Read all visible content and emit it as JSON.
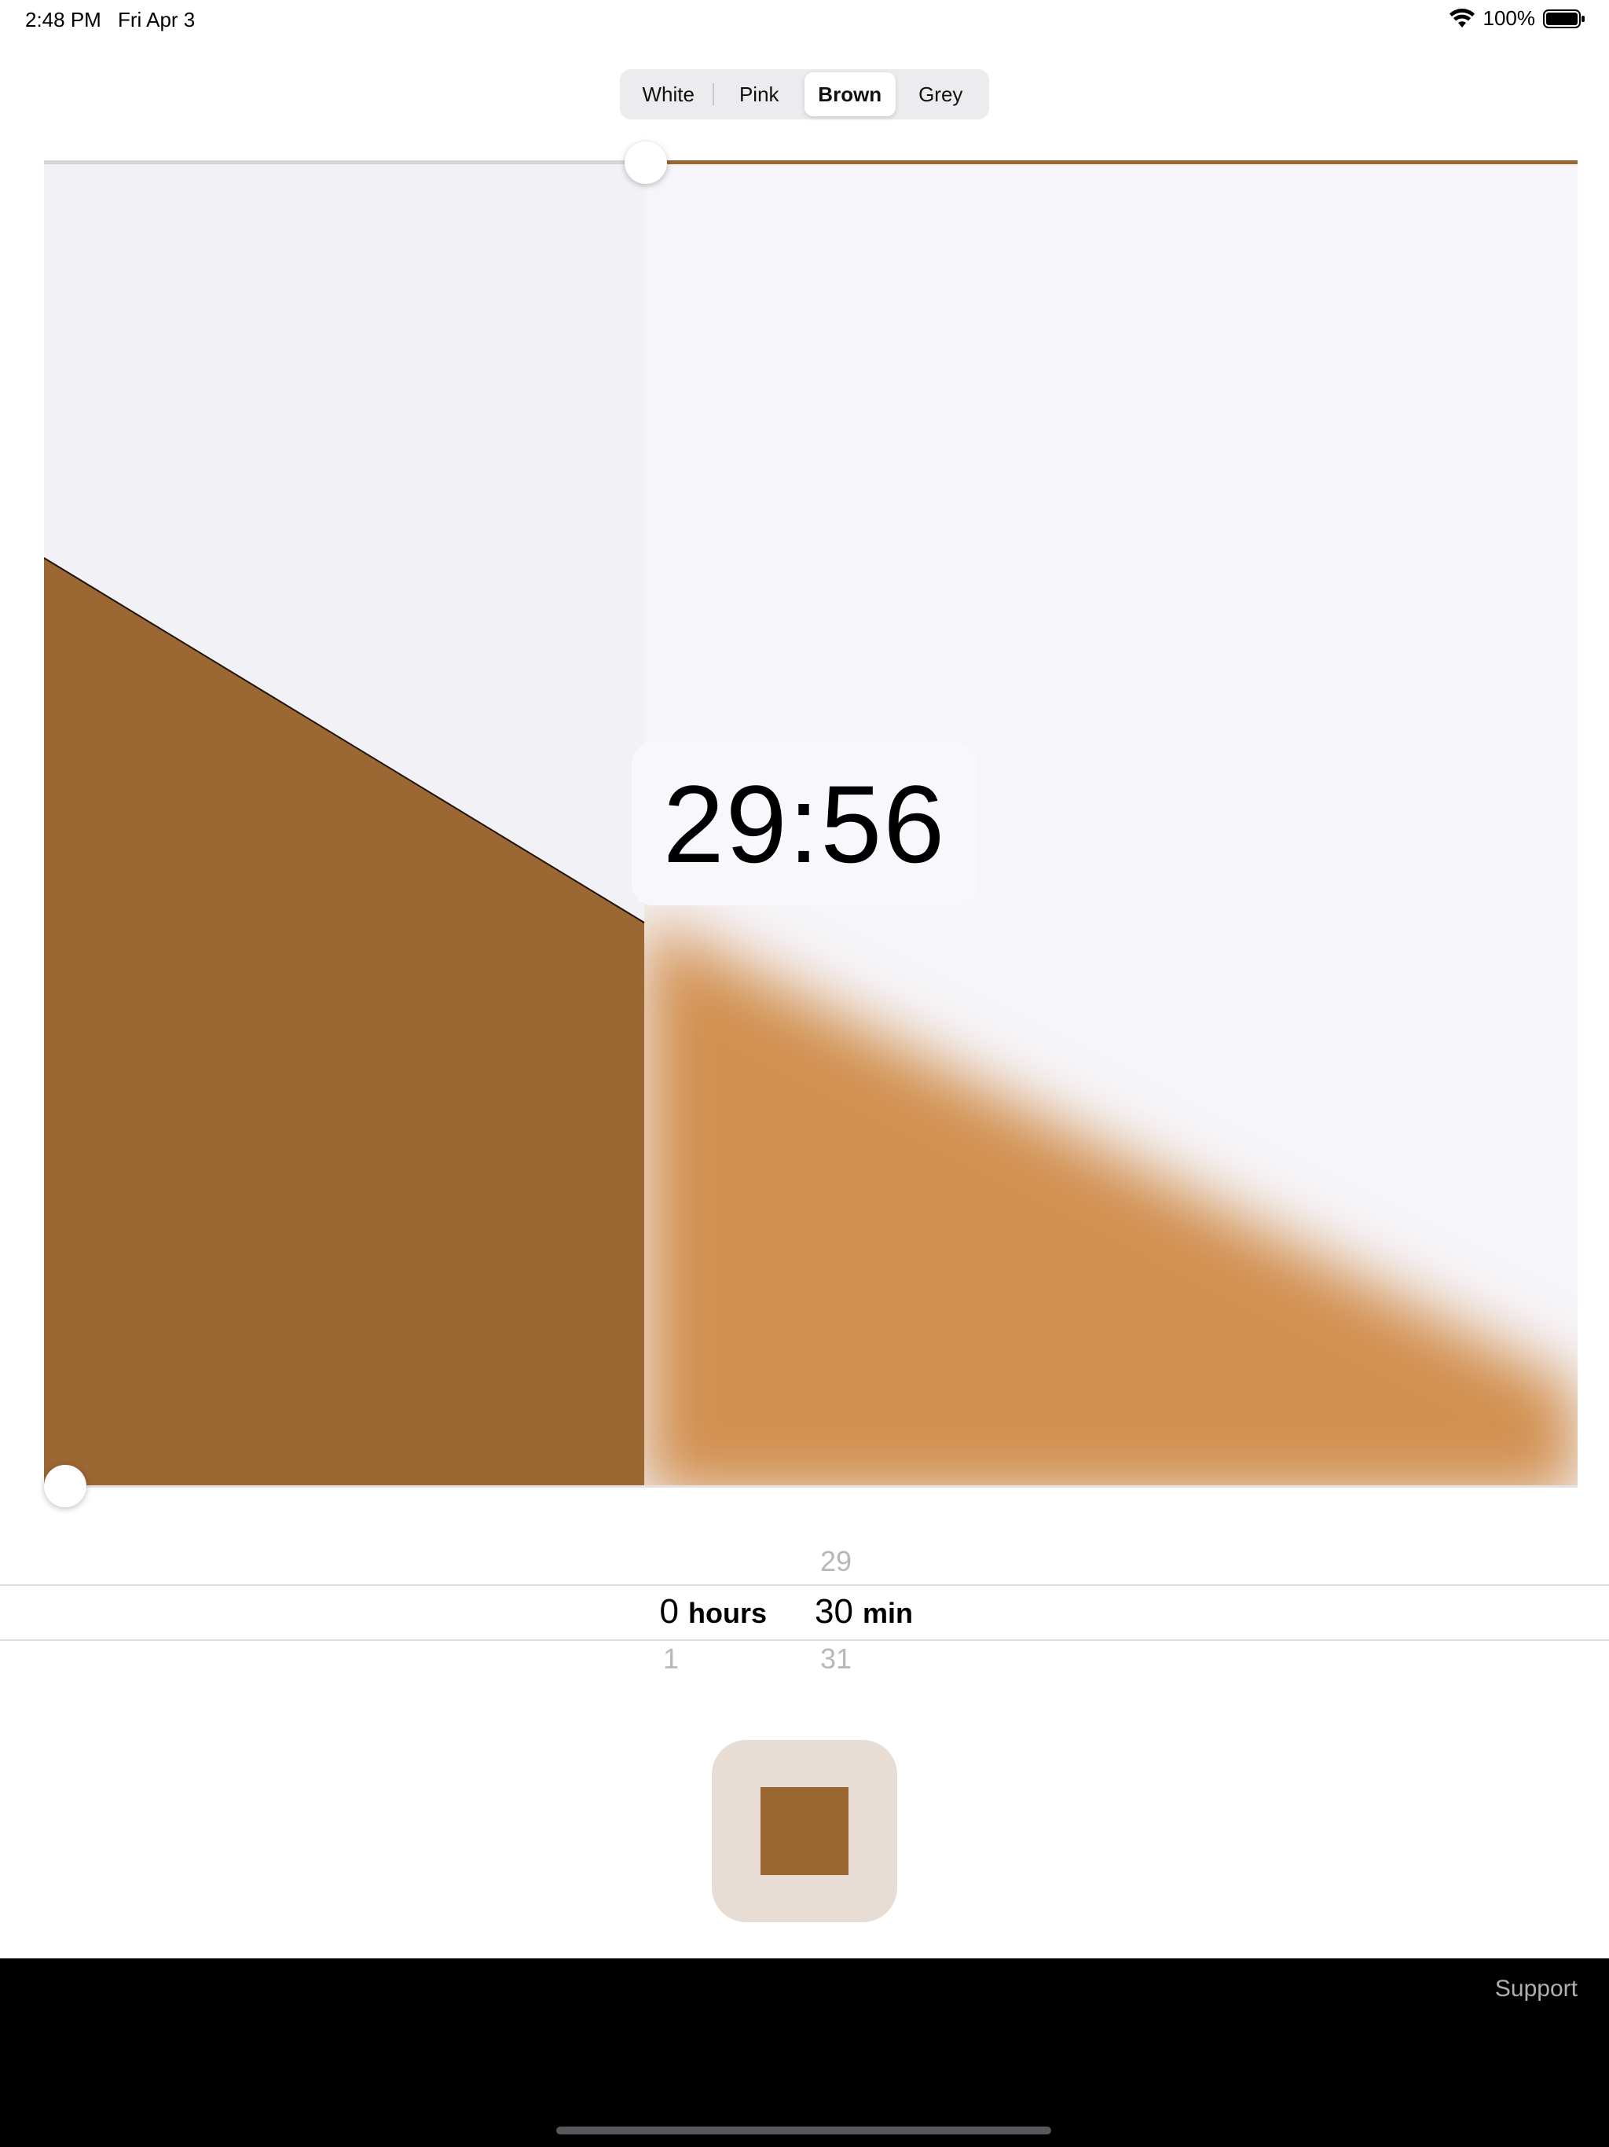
{
  "status_bar": {
    "time": "2:48 PM",
    "date": "Fri Apr 3",
    "battery": "100%"
  },
  "noise_selector": {
    "options": [
      "White",
      "Pink",
      "Brown",
      "Grey"
    ],
    "selected": "Brown"
  },
  "timer": {
    "remaining": "29:56"
  },
  "duration_picker": {
    "hours": {
      "above": "",
      "current": "0",
      "below": "1",
      "unit": "hours"
    },
    "minutes": {
      "above": "29",
      "current": "30",
      "below": "31",
      "unit": "min"
    }
  },
  "stop_button": {
    "icon": "stop-icon"
  },
  "footer": {
    "support_label": "Support"
  },
  "colors": {
    "accent_brown": "#9b6733",
    "light_brown": "#d19050",
    "background": "#f3f2f7",
    "stop_button_bg": "#e7ddd4"
  }
}
